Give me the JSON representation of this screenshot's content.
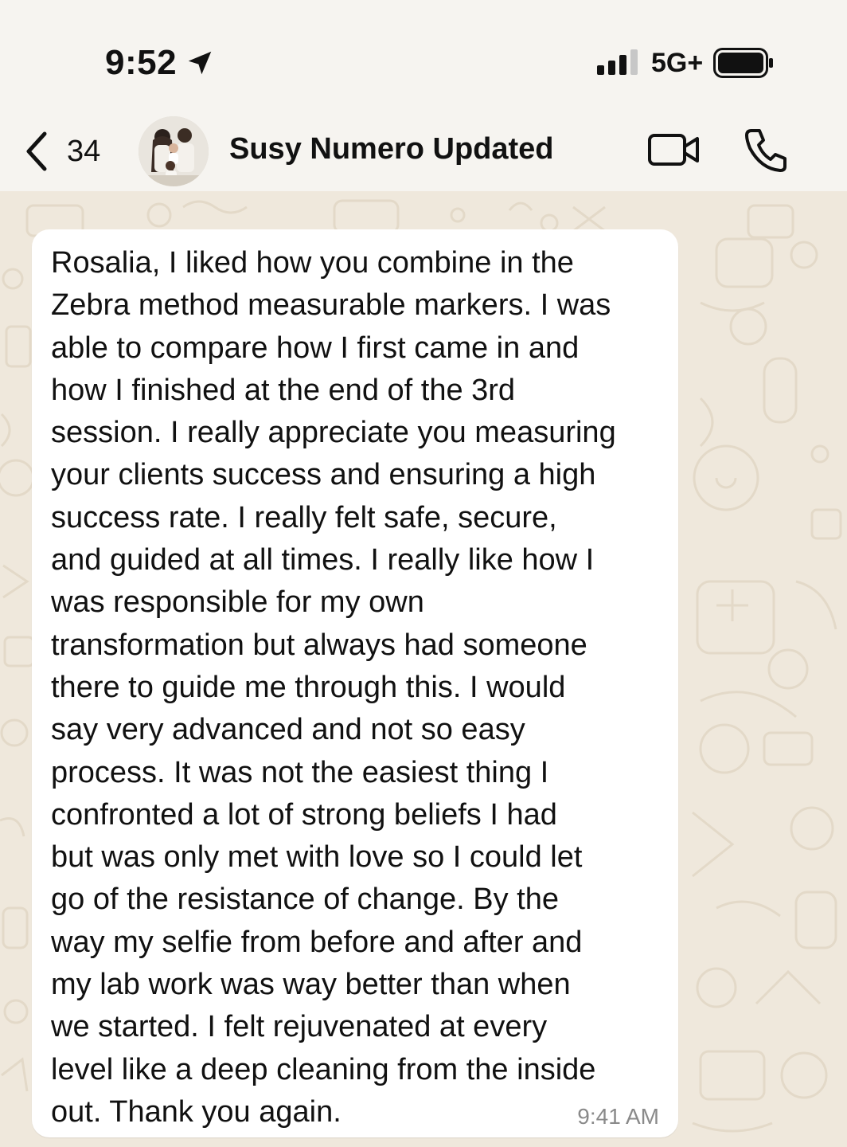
{
  "status_bar": {
    "time": "9:52",
    "network": "5G+",
    "icons": [
      "location-arrow-icon",
      "signal-icon",
      "battery-icon"
    ]
  },
  "header": {
    "back_count": "34",
    "contact_name": "Susy Numero Updated",
    "icons": [
      "chevron-left-icon",
      "video-call-icon",
      "phone-icon"
    ]
  },
  "message": {
    "text": "Rosalia, I liked how you combine in the\nZebra method measurable markers. I was\nable to compare how I first came in and\nhow I finished at the end of the 3rd\nsession. I really appreciate you measuring\nyour clients success and ensuring a high\nsuccess rate. I really felt safe, secure,\nand guided at all times. I really like how I\nwas responsible for my own\ntransformation but always had someone\nthere to guide me through this. I would\nsay very advanced and not so easy\nprocess. It was not the easiest thing I\nconfronted a lot of strong beliefs I had\nbut was only met with love so I could let\ngo of the resistance of change. By the\nway my selfie from before and after and\nmy lab work was way better than when\nwe started. I felt rejuvenated at every\nlevel like a deep cleaning from the inside\nout. Thank you again.",
    "time": "9:41 AM"
  },
  "colors": {
    "background": "#f6f4f0",
    "chat_wallpaper": "#efe8dc",
    "bubble": "#ffffff",
    "timestamp": "#8a8a8a"
  }
}
